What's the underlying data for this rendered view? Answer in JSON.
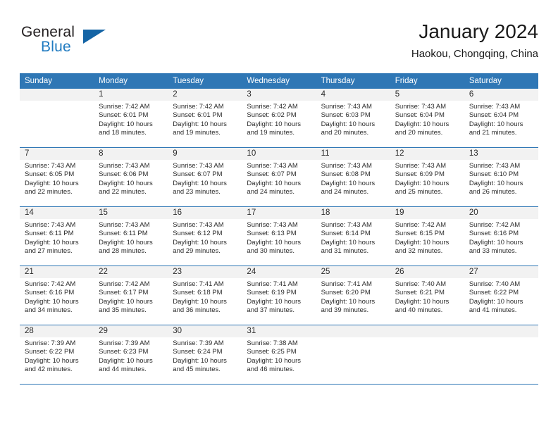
{
  "logo": {
    "top_text": "General",
    "bottom_text": "Blue",
    "triangle_icon": "triangle-icon",
    "brand_blue": "#1f7ac0",
    "triangle_blue": "#1464a5",
    "dark": "#231f20"
  },
  "header": {
    "month_title": "January 2024",
    "location": "Haokou, Chongqing, China"
  },
  "calendar": {
    "header_color": "#2f77b5",
    "band_color": "#f2f2f2",
    "weekday_headers": [
      "Sunday",
      "Monday",
      "Tuesday",
      "Wednesday",
      "Thursday",
      "Friday",
      "Saturday"
    ],
    "weeks": [
      [
        {
          "day": "",
          "blank": true,
          "sunrise": "",
          "sunset": "",
          "daylight_line1": "",
          "daylight_line2": ""
        },
        {
          "day": "1",
          "blank": false,
          "sunrise": "Sunrise: 7:42 AM",
          "sunset": "Sunset: 6:01 PM",
          "daylight_line1": "Daylight: 10 hours",
          "daylight_line2": "and 18 minutes."
        },
        {
          "day": "2",
          "blank": false,
          "sunrise": "Sunrise: 7:42 AM",
          "sunset": "Sunset: 6:01 PM",
          "daylight_line1": "Daylight: 10 hours",
          "daylight_line2": "and 19 minutes."
        },
        {
          "day": "3",
          "blank": false,
          "sunrise": "Sunrise: 7:42 AM",
          "sunset": "Sunset: 6:02 PM",
          "daylight_line1": "Daylight: 10 hours",
          "daylight_line2": "and 19 minutes."
        },
        {
          "day": "4",
          "blank": false,
          "sunrise": "Sunrise: 7:43 AM",
          "sunset": "Sunset: 6:03 PM",
          "daylight_line1": "Daylight: 10 hours",
          "daylight_line2": "and 20 minutes."
        },
        {
          "day": "5",
          "blank": false,
          "sunrise": "Sunrise: 7:43 AM",
          "sunset": "Sunset: 6:04 PM",
          "daylight_line1": "Daylight: 10 hours",
          "daylight_line2": "and 20 minutes."
        },
        {
          "day": "6",
          "blank": false,
          "sunrise": "Sunrise: 7:43 AM",
          "sunset": "Sunset: 6:04 PM",
          "daylight_line1": "Daylight: 10 hours",
          "daylight_line2": "and 21 minutes."
        }
      ],
      [
        {
          "day": "7",
          "blank": false,
          "sunrise": "Sunrise: 7:43 AM",
          "sunset": "Sunset: 6:05 PM",
          "daylight_line1": "Daylight: 10 hours",
          "daylight_line2": "and 22 minutes."
        },
        {
          "day": "8",
          "blank": false,
          "sunrise": "Sunrise: 7:43 AM",
          "sunset": "Sunset: 6:06 PM",
          "daylight_line1": "Daylight: 10 hours",
          "daylight_line2": "and 22 minutes."
        },
        {
          "day": "9",
          "blank": false,
          "sunrise": "Sunrise: 7:43 AM",
          "sunset": "Sunset: 6:07 PM",
          "daylight_line1": "Daylight: 10 hours",
          "daylight_line2": "and 23 minutes."
        },
        {
          "day": "10",
          "blank": false,
          "sunrise": "Sunrise: 7:43 AM",
          "sunset": "Sunset: 6:07 PM",
          "daylight_line1": "Daylight: 10 hours",
          "daylight_line2": "and 24 minutes."
        },
        {
          "day": "11",
          "blank": false,
          "sunrise": "Sunrise: 7:43 AM",
          "sunset": "Sunset: 6:08 PM",
          "daylight_line1": "Daylight: 10 hours",
          "daylight_line2": "and 24 minutes."
        },
        {
          "day": "12",
          "blank": false,
          "sunrise": "Sunrise: 7:43 AM",
          "sunset": "Sunset: 6:09 PM",
          "daylight_line1": "Daylight: 10 hours",
          "daylight_line2": "and 25 minutes."
        },
        {
          "day": "13",
          "blank": false,
          "sunrise": "Sunrise: 7:43 AM",
          "sunset": "Sunset: 6:10 PM",
          "daylight_line1": "Daylight: 10 hours",
          "daylight_line2": "and 26 minutes."
        }
      ],
      [
        {
          "day": "14",
          "blank": false,
          "sunrise": "Sunrise: 7:43 AM",
          "sunset": "Sunset: 6:11 PM",
          "daylight_line1": "Daylight: 10 hours",
          "daylight_line2": "and 27 minutes."
        },
        {
          "day": "15",
          "blank": false,
          "sunrise": "Sunrise: 7:43 AM",
          "sunset": "Sunset: 6:11 PM",
          "daylight_line1": "Daylight: 10 hours",
          "daylight_line2": "and 28 minutes."
        },
        {
          "day": "16",
          "blank": false,
          "sunrise": "Sunrise: 7:43 AM",
          "sunset": "Sunset: 6:12 PM",
          "daylight_line1": "Daylight: 10 hours",
          "daylight_line2": "and 29 minutes."
        },
        {
          "day": "17",
          "blank": false,
          "sunrise": "Sunrise: 7:43 AM",
          "sunset": "Sunset: 6:13 PM",
          "daylight_line1": "Daylight: 10 hours",
          "daylight_line2": "and 30 minutes."
        },
        {
          "day": "18",
          "blank": false,
          "sunrise": "Sunrise: 7:43 AM",
          "sunset": "Sunset: 6:14 PM",
          "daylight_line1": "Daylight: 10 hours",
          "daylight_line2": "and 31 minutes."
        },
        {
          "day": "19",
          "blank": false,
          "sunrise": "Sunrise: 7:42 AM",
          "sunset": "Sunset: 6:15 PM",
          "daylight_line1": "Daylight: 10 hours",
          "daylight_line2": "and 32 minutes."
        },
        {
          "day": "20",
          "blank": false,
          "sunrise": "Sunrise: 7:42 AM",
          "sunset": "Sunset: 6:16 PM",
          "daylight_line1": "Daylight: 10 hours",
          "daylight_line2": "and 33 minutes."
        }
      ],
      [
        {
          "day": "21",
          "blank": false,
          "sunrise": "Sunrise: 7:42 AM",
          "sunset": "Sunset: 6:16 PM",
          "daylight_line1": "Daylight: 10 hours",
          "daylight_line2": "and 34 minutes."
        },
        {
          "day": "22",
          "blank": false,
          "sunrise": "Sunrise: 7:42 AM",
          "sunset": "Sunset: 6:17 PM",
          "daylight_line1": "Daylight: 10 hours",
          "daylight_line2": "and 35 minutes."
        },
        {
          "day": "23",
          "blank": false,
          "sunrise": "Sunrise: 7:41 AM",
          "sunset": "Sunset: 6:18 PM",
          "daylight_line1": "Daylight: 10 hours",
          "daylight_line2": "and 36 minutes."
        },
        {
          "day": "24",
          "blank": false,
          "sunrise": "Sunrise: 7:41 AM",
          "sunset": "Sunset: 6:19 PM",
          "daylight_line1": "Daylight: 10 hours",
          "daylight_line2": "and 37 minutes."
        },
        {
          "day": "25",
          "blank": false,
          "sunrise": "Sunrise: 7:41 AM",
          "sunset": "Sunset: 6:20 PM",
          "daylight_line1": "Daylight: 10 hours",
          "daylight_line2": "and 39 minutes."
        },
        {
          "day": "26",
          "blank": false,
          "sunrise": "Sunrise: 7:40 AM",
          "sunset": "Sunset: 6:21 PM",
          "daylight_line1": "Daylight: 10 hours",
          "daylight_line2": "and 40 minutes."
        },
        {
          "day": "27",
          "blank": false,
          "sunrise": "Sunrise: 7:40 AM",
          "sunset": "Sunset: 6:22 PM",
          "daylight_line1": "Daylight: 10 hours",
          "daylight_line2": "and 41 minutes."
        }
      ],
      [
        {
          "day": "28",
          "blank": false,
          "sunrise": "Sunrise: 7:39 AM",
          "sunset": "Sunset: 6:22 PM",
          "daylight_line1": "Daylight: 10 hours",
          "daylight_line2": "and 42 minutes."
        },
        {
          "day": "29",
          "blank": false,
          "sunrise": "Sunrise: 7:39 AM",
          "sunset": "Sunset: 6:23 PM",
          "daylight_line1": "Daylight: 10 hours",
          "daylight_line2": "and 44 minutes."
        },
        {
          "day": "30",
          "blank": false,
          "sunrise": "Sunrise: 7:39 AM",
          "sunset": "Sunset: 6:24 PM",
          "daylight_line1": "Daylight: 10 hours",
          "daylight_line2": "and 45 minutes."
        },
        {
          "day": "31",
          "blank": false,
          "sunrise": "Sunrise: 7:38 AM",
          "sunset": "Sunset: 6:25 PM",
          "daylight_line1": "Daylight: 10 hours",
          "daylight_line2": "and 46 minutes."
        },
        {
          "day": "",
          "blank": true,
          "sunrise": "",
          "sunset": "",
          "daylight_line1": "",
          "daylight_line2": ""
        },
        {
          "day": "",
          "blank": true,
          "sunrise": "",
          "sunset": "",
          "daylight_line1": "",
          "daylight_line2": ""
        },
        {
          "day": "",
          "blank": true,
          "sunrise": "",
          "sunset": "",
          "daylight_line1": "",
          "daylight_line2": ""
        }
      ]
    ]
  }
}
